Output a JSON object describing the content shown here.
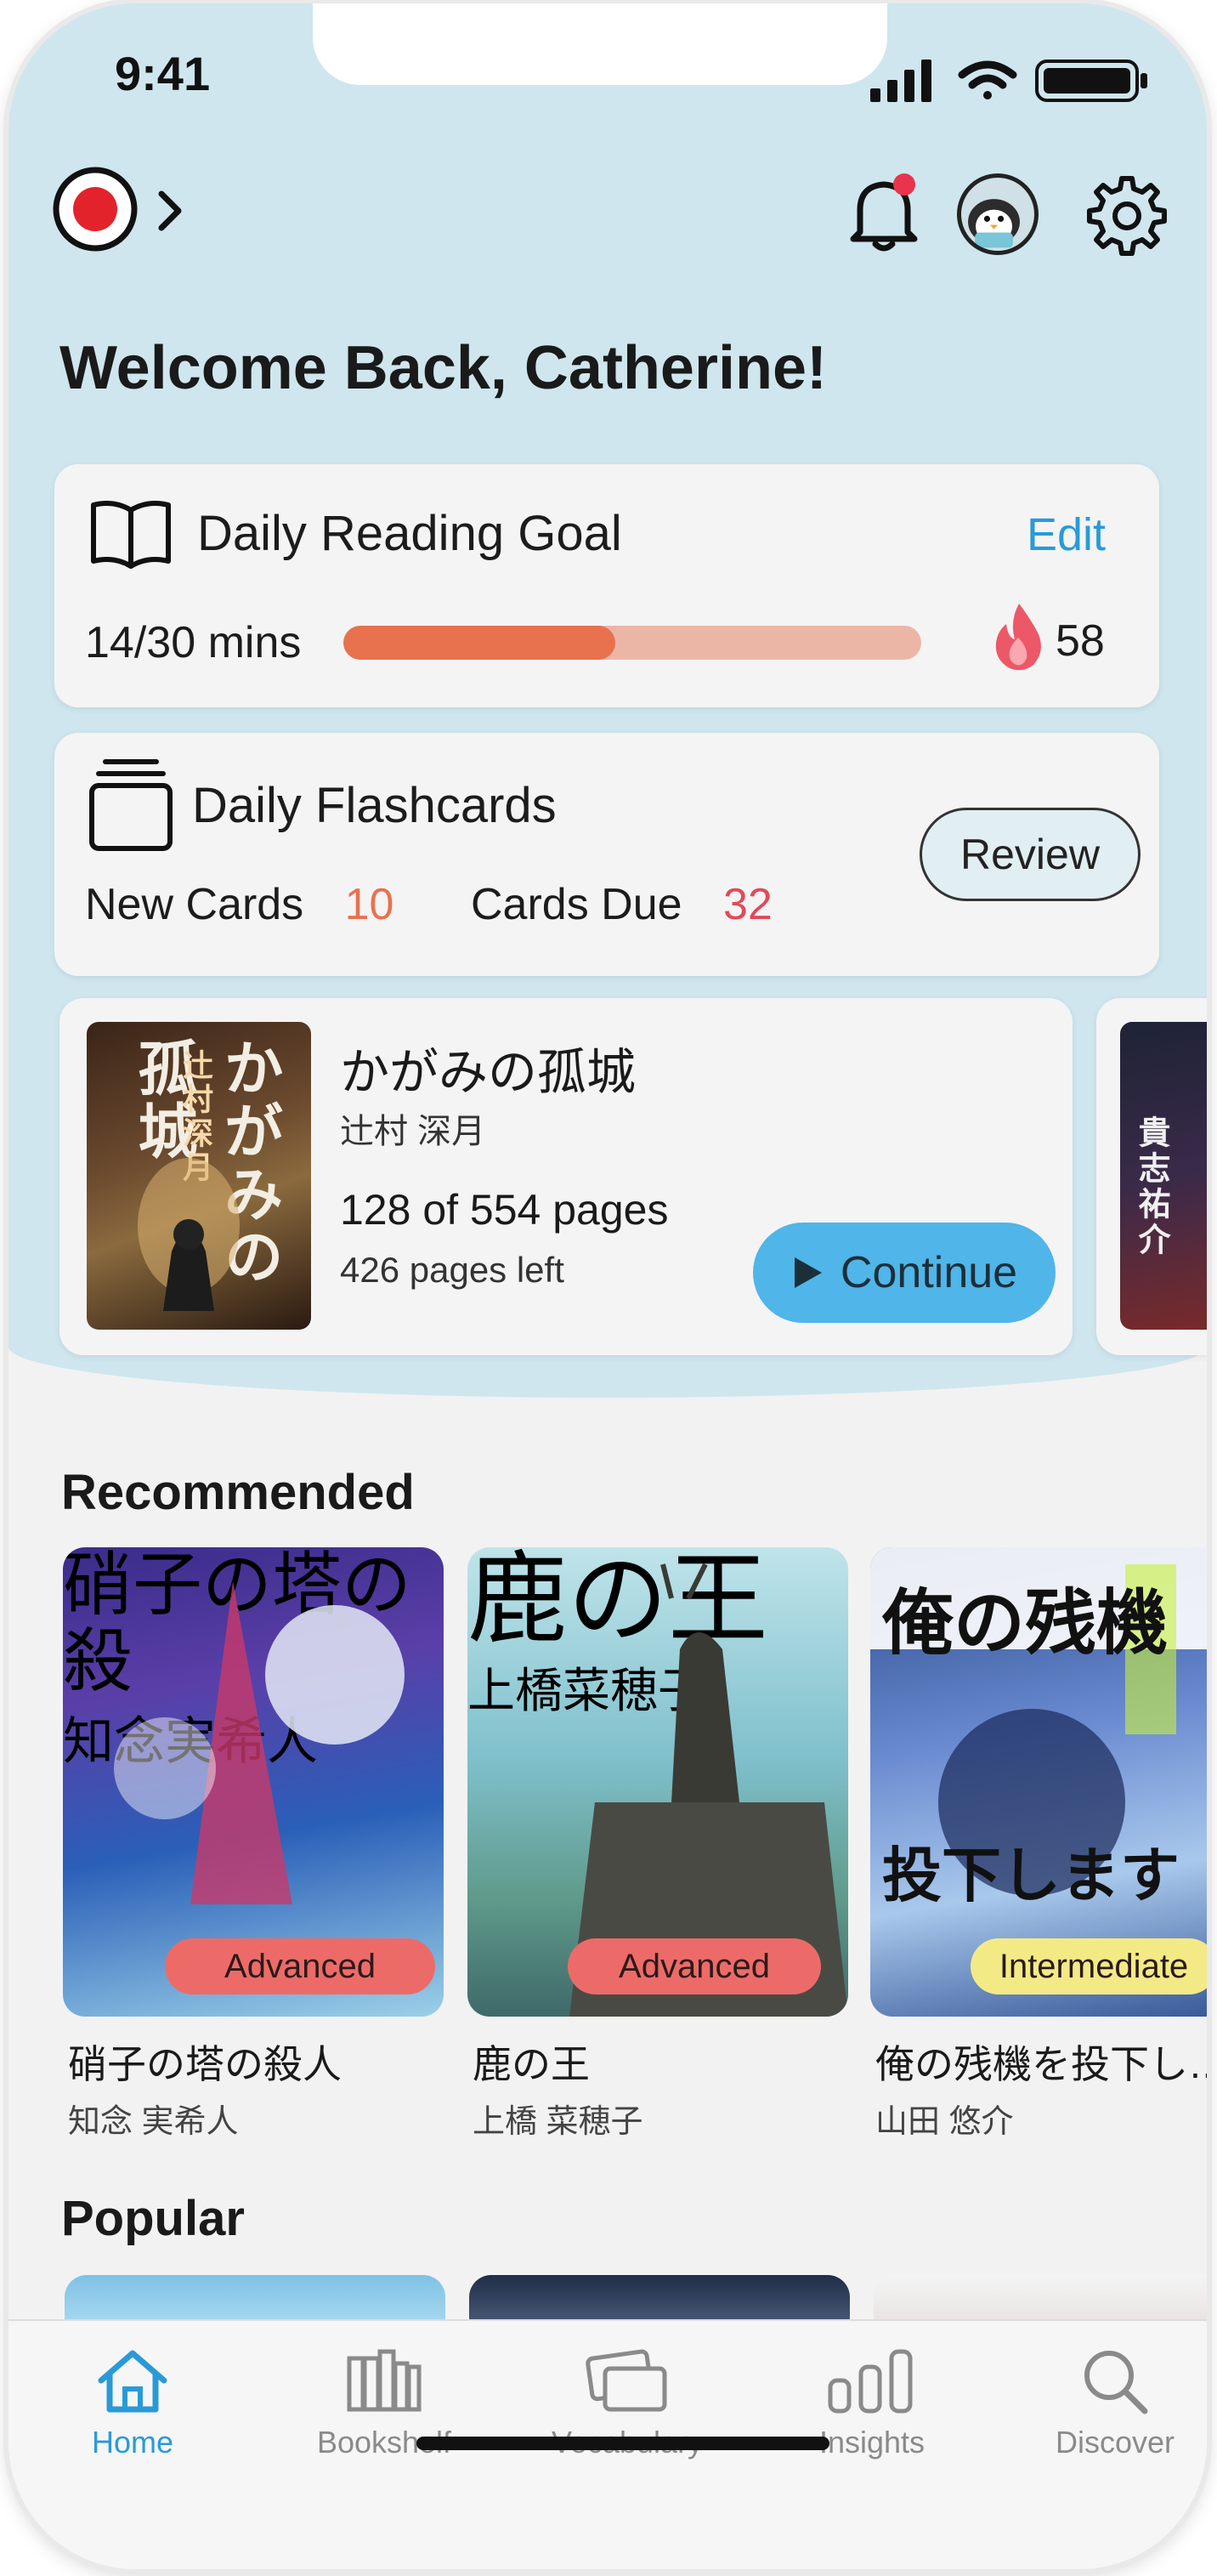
{
  "status_bar": {
    "time": "9:41"
  },
  "header": {
    "greeting": "Welcome Back, Catherine!"
  },
  "reading_goal": {
    "title": "Daily Reading Goal",
    "edit_label": "Edit",
    "progress_text": "14/30 mins",
    "progress_fraction": 0.47,
    "streak": "58",
    "colors": {
      "fill": "#e8714e",
      "track": "#ecb6a7"
    }
  },
  "flashcards": {
    "title": "Daily Flashcards",
    "new_cards_label": "New Cards",
    "new_cards_count": "10",
    "due_label": "Cards Due",
    "due_count": "32",
    "review_label": "Review"
  },
  "current_book": {
    "title": "かがみの孤城",
    "author": "辻村 深月",
    "progress": "128 of 554 pages",
    "pages_left": "426 pages left",
    "continue_label": "Continue",
    "cover_text": "かがみの孤城",
    "cover_author": "辻村深月"
  },
  "next_book": {
    "cover_author": "貴志祐介"
  },
  "recommended": {
    "title": "Recommended",
    "books": [
      {
        "title": "硝子の塔の殺人",
        "author": "知念 実希人",
        "level": "Advanced",
        "cover_text": "硝子の塔の殺",
        "cover_author": "知念実希人"
      },
      {
        "title": "鹿の王",
        "author": "上橋 菜穂子",
        "level": "Advanced",
        "cover_text": "鹿の王",
        "cover_author": "上橋菜穂子"
      },
      {
        "title": "俺の残機を投下し…",
        "author": "山田 悠介",
        "level": "Intermediate",
        "cover_text": "俺の残機",
        "cover_text2": "投下します"
      }
    ]
  },
  "popular": {
    "title": "Popular"
  },
  "tabbar": {
    "tabs": [
      {
        "label": "Home",
        "icon": "home-icon",
        "active": true
      },
      {
        "label": "Bookshelf",
        "icon": "bookshelf-icon"
      },
      {
        "label": "Vocabulary",
        "icon": "vocabulary-icon"
      },
      {
        "label": "Insights",
        "icon": "insights-icon"
      },
      {
        "label": "Discover",
        "icon": "search-icon"
      }
    ]
  },
  "colors": {
    "accent": "#2a9ad7",
    "header_bg": "#cfe6ee",
    "advanced": "#ec6b68",
    "intermediate": "#f3ea86",
    "continue": "#50b5e8"
  }
}
